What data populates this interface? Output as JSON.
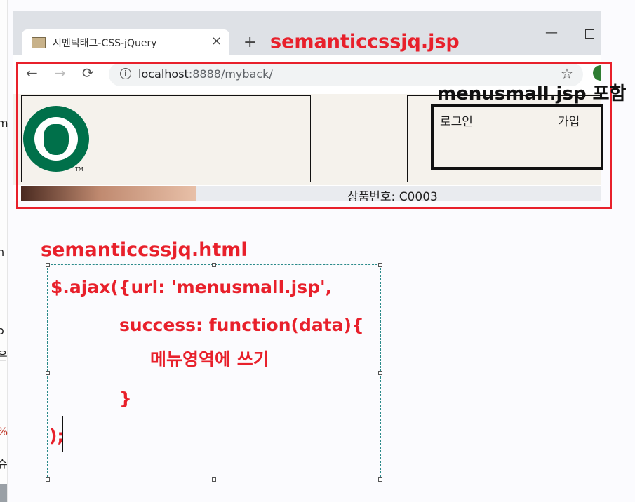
{
  "browser": {
    "tab_title": "시멘틱태그-CSS-jQuery",
    "tab_close": "×",
    "new_tab": "+",
    "window_minimize": "—",
    "url_host": "localhost",
    "url_rest": ":8888/myback/",
    "icons": {
      "back": "back-arrow-icon",
      "forward": "forward-arrow-icon",
      "reload": "reload-icon",
      "info": "info-icon",
      "bookmark": "star-icon",
      "favicon": "page-favicon-icon"
    }
  },
  "page": {
    "logo_tm": "TM",
    "menu": {
      "login": "로그인",
      "join": "가입"
    },
    "product_text": "상품번호: C0003"
  },
  "annotations": {
    "jsp_label": "semanticcssjq.jsp",
    "menu_label": "menusmall.jsp 포함",
    "html_label": "semanticcssjq.html",
    "code_lines": [
      "$.ajax({url: 'menusmall.jsp',",
      "success: function(data){",
      "메뉴영역에 쓰기",
      "}",
      ");"
    ],
    "colors": {
      "annotation_red": "#e8202b",
      "logo_green": "#00704a"
    }
  },
  "left_strip": {
    "fragments": [
      "m",
      "n",
      "o",
      "은",
      "%",
      "슈"
    ]
  }
}
